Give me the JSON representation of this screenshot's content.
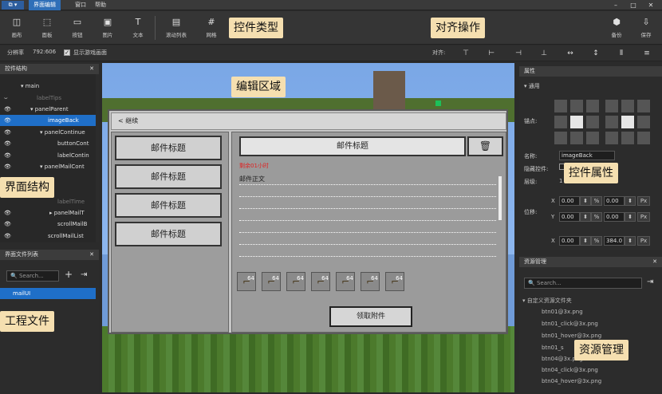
{
  "menu": {
    "app": "⧉ ▾",
    "items": [
      "界面编辑",
      "窗口",
      "帮助"
    ]
  },
  "window": {
    "minimize": "–",
    "maximize": "□",
    "close": "✕"
  },
  "toolbar": {
    "tools": [
      {
        "icon": "◫",
        "label": "画布"
      },
      {
        "icon": "⬚",
        "label": "面板"
      },
      {
        "icon": "▭",
        "label": "按钮"
      },
      {
        "icon": "▣",
        "label": "图片"
      },
      {
        "icon": "T",
        "label": "文本"
      },
      {
        "icon": "▤",
        "label": "滚动列表"
      },
      {
        "icon": "#",
        "label": "网格"
      }
    ],
    "backup": {
      "icon": "⬢",
      "label": "备份"
    },
    "save": {
      "icon": "⇩",
      "label": "保存"
    }
  },
  "options": {
    "resolution_label": "分辨率",
    "resolution_value": "792:606",
    "show_game_label": "显示游戏画面",
    "show_game_checked": "✓",
    "align_label": "对齐:"
  },
  "align_icons": [
    "⊤",
    "⊢",
    "⊣",
    "⊥",
    "↔",
    "↕",
    "⫴",
    "≡"
  ],
  "structure": {
    "title": "控件结构",
    "close": "✕",
    "rows": [
      {
        "eye": "",
        "label": "▾ main",
        "dim": false
      },
      {
        "eye": "",
        "label": "labelTips",
        "dim": true
      },
      {
        "eye": "👁",
        "label": "▾ panelParent",
        "dim": false
      },
      {
        "eye": "👁",
        "label": "imageBack",
        "dim": false,
        "sel": true
      },
      {
        "eye": "👁",
        "label": "▾ panelContinue",
        "dim": false
      },
      {
        "eye": "👁",
        "label": "buttonCont",
        "dim": false
      },
      {
        "eye": "👁",
        "label": "labelContin",
        "dim": false
      },
      {
        "eye": "👁",
        "label": "▾ panelMailCont",
        "dim": false
      },
      {
        "eye": "",
        "label": "labelTime",
        "dim": true
      },
      {
        "eye": "👁",
        "label": "▸ panelMailT",
        "dim": false
      },
      {
        "eye": "👁",
        "label": "scrollMailB",
        "dim": false
      },
      {
        "eye": "👁",
        "label": "scrollMailList",
        "dim": false
      }
    ]
  },
  "files": {
    "title": "界面文件列表",
    "close": "✕",
    "search_placeholder": "Search...",
    "add": "+",
    "import": "⇥",
    "items": [
      "mailUI"
    ]
  },
  "callouts": {
    "widget_types": "控件类型",
    "align_ops": "对齐操作",
    "edit_area": "编辑区域",
    "ui_structure": "界面结构",
    "widget_props": "控件属性",
    "project_files": "工程文件",
    "res_mgmt": "资源管理"
  },
  "dialog": {
    "back": "< 继续",
    "mail_titles": [
      "邮件标题",
      "邮件标题",
      "邮件标题",
      "邮件标题"
    ],
    "title": "邮件标题",
    "delete_icon": "🗑",
    "remaining": "剩余01小时",
    "body": "邮件正文",
    "item_count": "64",
    "item_icon": "⌐",
    "get_button": "领取附件",
    "items_n": 7
  },
  "props": {
    "title": "属性",
    "section": "▾ 通用",
    "close": "✕",
    "anchor_label": "锚点:",
    "name_label": "名称:",
    "name_value": "imageBack",
    "hide_label": "隐藏控件:",
    "layer_label": "层级:",
    "layer_value": "1",
    "pos_label": "位移:",
    "x": "X",
    "y": "Y",
    "vals": [
      "0.00",
      "0.00",
      "0.00",
      "0.00",
      "0.00",
      "384.0"
    ],
    "pct": "%",
    "px": "Px",
    "stepper": "⬍"
  },
  "resources": {
    "title": "资源管理",
    "close": "✕",
    "search_placeholder": "Search...",
    "import": "⇥",
    "folder": "▾ 自定义资源文件夹",
    "files": [
      "btn01@3x.png",
      "btn01_click@3x.png",
      "btn01_hover@3x.png",
      "btn01_s",
      "btn04@3x.png",
      "btn04_click@3x.png",
      "btn04_hover@3x.png"
    ]
  }
}
